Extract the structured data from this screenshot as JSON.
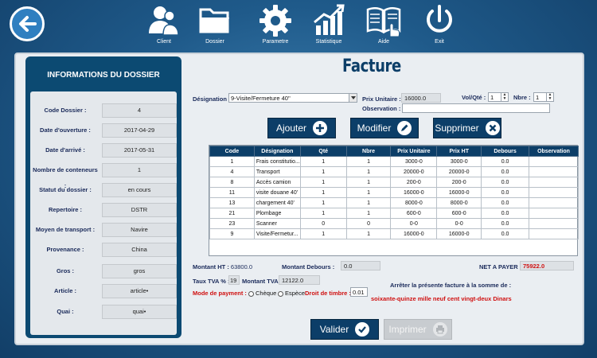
{
  "topbar": {
    "back_icon": "arrow-left-icon",
    "items": [
      {
        "label": "Client",
        "icon": "users-icon"
      },
      {
        "label": "Dossier",
        "icon": "folder-icon"
      },
      {
        "label": "Parametre",
        "icon": "gear-icon"
      },
      {
        "label": "Statistique",
        "icon": "bar-chart-icon"
      },
      {
        "label": "Aide",
        "icon": "book-help-icon"
      },
      {
        "label": "Exit",
        "icon": "power-icon"
      }
    ]
  },
  "sidebar": {
    "title": "INFORMATIONS DU DOSSIER",
    "rows": [
      {
        "label": "Code Dossier :",
        "value": "4"
      },
      {
        "label": "Date d'ouverture :",
        "value": "2017-04-29"
      },
      {
        "label": "Date d'arrivé :",
        "value": "2017-05-31"
      },
      {
        "label": "Nombre de conteneurs :",
        "value": "1"
      },
      {
        "label": "Statut du dossier :",
        "value": "en cours"
      },
      {
        "label": "Repertoire :",
        "value": "DSTR"
      },
      {
        "label": "Moyen de transport :",
        "value": "Navire"
      },
      {
        "label": "Provenance :",
        "value": "China"
      },
      {
        "label": "Gros :",
        "value": "gros"
      },
      {
        "label": "Article :",
        "value": "article•"
      },
      {
        "label": "Quai :",
        "value": "quai•"
      }
    ]
  },
  "invoice": {
    "title": "Facture",
    "designation_label": "Désignation :",
    "designation_value": "9-Visite/Fermeture 40''",
    "prix_unitaire_label": "Prix Unitaire :",
    "prix_unitaire_value": "16000.0",
    "vol_qte_label": "Vol/Qté :",
    "vol_qte_value": "1",
    "nbre_label": "Nbre :",
    "nbre_value": "1",
    "observation_label": "Observation :",
    "observation_value": "",
    "buttons": {
      "ajouter": "Ajouter",
      "modifier": "Modifier",
      "supprimer": "Supprimer"
    },
    "table": {
      "headers": [
        "Code",
        "Désignation",
        "Qté",
        "Nbre",
        "Prix Unitaire",
        "Prix HT",
        "Debours",
        "Observation"
      ],
      "rows": [
        [
          "1",
          "Frais constitutio...",
          "1",
          "1",
          "3000-0",
          "3000-0",
          "0.0",
          ""
        ],
        [
          "4",
          "Transport",
          "1",
          "1",
          "20000-0",
          "20000-0",
          "0.0",
          ""
        ],
        [
          "8",
          "Accès camion",
          "1",
          "1",
          "200-0",
          "200-0",
          "0.0",
          ""
        ],
        [
          "11",
          "visite douane 40'",
          "1",
          "1",
          "16000-0",
          "16000-0",
          "0.0",
          ""
        ],
        [
          "13",
          "chargement 40'",
          "1",
          "1",
          "8000-0",
          "8000-0",
          "0.0",
          ""
        ],
        [
          "21",
          "Plombage",
          "1",
          "1",
          "600-0",
          "600-0",
          "0.0",
          ""
        ],
        [
          "23",
          "Scanner",
          "0",
          "0",
          "0-0",
          "0-0",
          "0.0",
          ""
        ],
        [
          "9",
          "Visite/Fermetur...",
          "1",
          "1",
          "16000-0",
          "16000-0",
          "0.0",
          ""
        ]
      ]
    },
    "montant_ht_label": "Montant HT :",
    "montant_ht_value": "63800.0",
    "montant_debours_label": "Montant Debours :",
    "montant_debours_value": "0.0",
    "net_a_payer_label": "NET A PAYER :",
    "net_a_payer_value": "75922.0",
    "taux_tva_label": "Taux TVA % :",
    "taux_tva_value": "19",
    "montant_tva_label": "Montant TVA :",
    "montant_tva_value": "12122.0",
    "arreter_text": "Arrêter la présente facture à la somme de :",
    "somme_lettres": "soixante-quinze mille neuf cent vingt-deux Dinars",
    "mode_payment_label": "Mode de payment :",
    "mode_cheque": "Chèque",
    "mode_espece": "Espèce",
    "droit_timbre_label": "Droit de timbre :",
    "droit_timbre_value": "0.01",
    "valider": "Valider",
    "imprimer": "Imprimer"
  },
  "colors": {
    "navy": "#0c3e68",
    "accent_red": "#d01010",
    "panel": "#eaeef2",
    "background": "#1f5a8a"
  }
}
